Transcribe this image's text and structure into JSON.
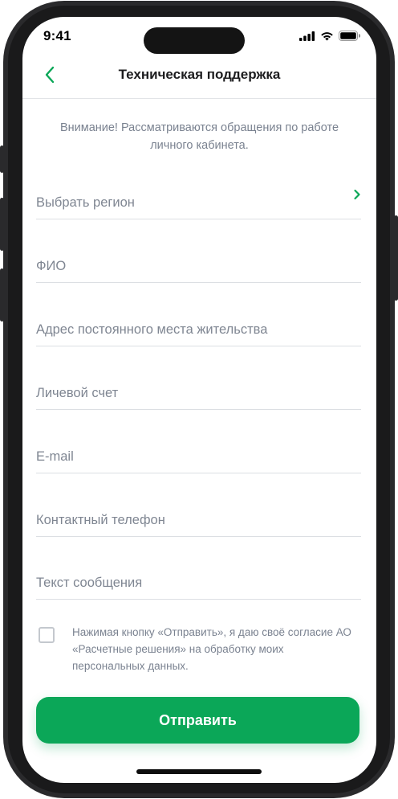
{
  "status_bar": {
    "time": "9:41"
  },
  "nav": {
    "title": "Техническая поддержка"
  },
  "notice": "Внимание! Рассматриваются обращения по работе личного кабинета.",
  "fields": {
    "region": {
      "placeholder": "Выбрать регион",
      "value": ""
    },
    "fio": {
      "placeholder": "ФИО",
      "value": ""
    },
    "address": {
      "placeholder": "Адрес постоянного места жительства",
      "value": ""
    },
    "account": {
      "placeholder": "Личевой счет",
      "value": ""
    },
    "email": {
      "placeholder": "E-mail",
      "value": ""
    },
    "phone": {
      "placeholder": "Контактный телефон",
      "value": ""
    },
    "message": {
      "placeholder": "Текст сообщения",
      "value": ""
    }
  },
  "consent": {
    "checked": false,
    "text": "Нажимая кнопку «Отправить», я даю своё согласие АО «Расчетные решения» на обработку моих персональных данных."
  },
  "submit_label": "Отправить",
  "icons": {
    "back": "chevron-left-icon",
    "region_chevron": "chevron-right-icon",
    "signal": "cellular-signal-icon",
    "wifi": "wifi-icon",
    "battery": "battery-icon"
  },
  "colors": {
    "accent": "#0ba758",
    "text_primary": "#1c1c1e",
    "text_secondary": "#7a8290",
    "divider": "#dcdfe3"
  }
}
